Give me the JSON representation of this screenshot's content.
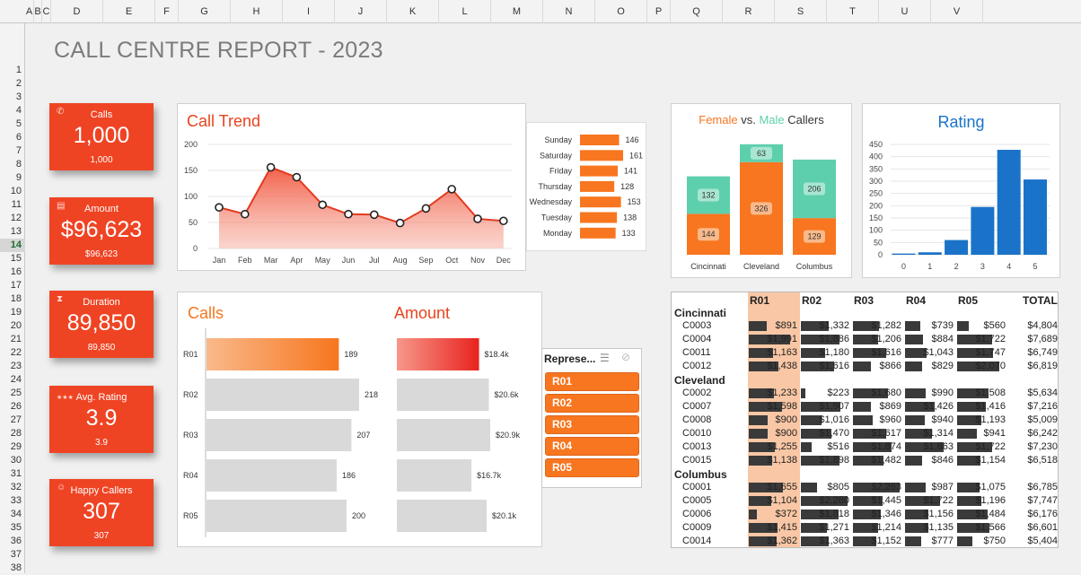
{
  "sheet": {
    "columns": [
      "A",
      "B",
      "C",
      "D",
      "E",
      "F",
      "G",
      "H",
      "I",
      "J",
      "K",
      "L",
      "M",
      "N",
      "O",
      "P",
      "Q",
      "R",
      "S",
      "T",
      "U",
      "V"
    ],
    "rows": [
      "1",
      "2",
      "3",
      "4",
      "5",
      "6",
      "7",
      "8",
      "9",
      "10",
      "11",
      "12",
      "13",
      "14",
      "15",
      "16",
      "17",
      "18",
      "19",
      "20",
      "21",
      "22",
      "23",
      "24",
      "25",
      "26",
      "27",
      "28",
      "29",
      "30",
      "31",
      "32",
      "33",
      "34",
      "35",
      "36",
      "37",
      "38"
    ],
    "selected_row": "14"
  },
  "title": "CALL CENTRE REPORT - 2023",
  "kpis": [
    {
      "label": "Calls",
      "value": "1,000",
      "sub": "1,000",
      "icon": "phone-icon"
    },
    {
      "label": "Amount",
      "value": "$96,623",
      "sub": "$96,623",
      "icon": "cash-register-icon"
    },
    {
      "label": "Duration",
      "value": "89,850",
      "sub": "89,850",
      "icon": "hourglass-icon"
    },
    {
      "label": "Avg. Rating",
      "value": "3.9",
      "sub": "3.9",
      "icon": "stars-icon"
    },
    {
      "label": "Happy Callers",
      "value": "307",
      "sub": "307",
      "icon": "smiley-icon"
    }
  ],
  "trend_title": "Call Trend",
  "gender_title": {
    "female": "Female",
    "vs": " vs. ",
    "male": "Male",
    "callers": " Callers"
  },
  "rating_title": "Rating",
  "calls_title": "Calls",
  "amount_title": "Amount",
  "slicer": {
    "header": "Represe...",
    "items": [
      "R01",
      "R02",
      "R03",
      "R04",
      "R05"
    ]
  },
  "colors": {
    "accent": "#ef4424",
    "orange": "#f7761f",
    "teal": "#5ecfac",
    "blue": "#1a73c8"
  },
  "chart_data": [
    {
      "type": "area",
      "title": "Call Trend",
      "categories": [
        "Jan",
        "Feb",
        "Mar",
        "Apr",
        "May",
        "Jun",
        "Jul",
        "Aug",
        "Sep",
        "Oct",
        "Nov",
        "Dec"
      ],
      "values": [
        79,
        66,
        156,
        137,
        84,
        66,
        65,
        49,
        77,
        114,
        57,
        53
      ],
      "ylim": [
        0,
        200
      ],
      "yticks": [
        0,
        50,
        100,
        150,
        200
      ]
    },
    {
      "type": "bar",
      "orientation": "horizontal",
      "categories": [
        "Sunday",
        "Saturday",
        "Friday",
        "Thursday",
        "Wednesday",
        "Tuesday",
        "Monday"
      ],
      "values": [
        146,
        161,
        141,
        128,
        153,
        138,
        133
      ]
    },
    {
      "type": "bar",
      "stacked": true,
      "title": "Female vs. Male Callers",
      "categories": [
        "Cincinnati",
        "Cleveland",
        "Columbus"
      ],
      "series": [
        {
          "name": "Female",
          "values": [
            144,
            326,
            129
          ]
        },
        {
          "name": "Male",
          "values": [
            132,
            63,
            206
          ]
        }
      ]
    },
    {
      "type": "bar",
      "title": "Rating",
      "categories": [
        "0",
        "1",
        "2",
        "3",
        "4",
        "5"
      ],
      "values": [
        5,
        10,
        60,
        195,
        428,
        307
      ],
      "ylim": [
        0,
        450
      ],
      "yticks": [
        0,
        50,
        100,
        150,
        200,
        250,
        300,
        350,
        400,
        450
      ]
    },
    {
      "type": "bar",
      "orientation": "horizontal",
      "title": "Calls",
      "categories": [
        "R01",
        "R02",
        "R03",
        "R04",
        "R05"
      ],
      "values": [
        189,
        218,
        207,
        186,
        200
      ]
    },
    {
      "type": "bar",
      "orientation": "horizontal",
      "title": "Amount",
      "categories": [
        "R01",
        "R02",
        "R03",
        "R04",
        "R05"
      ],
      "values": [
        18.4,
        20.6,
        20.9,
        16.7,
        20.1
      ],
      "labels": [
        "$18.4k",
        "$20.6k",
        "$20.9k",
        "$16.7k",
        "$20.1k"
      ]
    },
    {
      "type": "table",
      "headers": [
        "R01",
        "R02",
        "R03",
        "R04",
        "R05",
        "TOTAL"
      ],
      "groups": [
        {
          "city": "Cincinnati",
          "rows": [
            {
              "code": "C0003",
              "vals": [
                891,
                1332,
                1282,
                739,
                560
              ],
              "labels": [
                "$891",
                "$1,332",
                "$1,282",
                "$739",
                "$560"
              ],
              "total": "$4,804"
            },
            {
              "code": "C0004",
              "vals": [
                1991,
                1886,
                1206,
                884,
                1722
              ],
              "labels": [
                "$1,991",
                "$1,886",
                "$1,206",
                "$884",
                "$1,722"
              ],
              "total": "$7,689"
            },
            {
              "code": "C0011",
              "vals": [
                1163,
                1180,
                1616,
                1043,
                1747
              ],
              "labels": [
                "$1,163",
                "$1,180",
                "$1,616",
                "$1,043",
                "$1,747"
              ],
              "total": "$6,749"
            },
            {
              "code": "C0012",
              "vals": [
                1438,
                1616,
                866,
                829,
                2070
              ],
              "labels": [
                "$1,438",
                "$1,616",
                "$866",
                "$829",
                "$2,070"
              ],
              "total": "$6,819"
            }
          ]
        },
        {
          "city": "Cleveland",
          "rows": [
            {
              "code": "C0002",
              "vals": [
                1233,
                223,
                1680,
                990,
                1508
              ],
              "labels": [
                "$1,233",
                "$223",
                "$1,680",
                "$990",
                "$1,508"
              ],
              "total": "$5,634"
            },
            {
              "code": "C0007",
              "vals": [
                1598,
                1907,
                869,
                1426,
                1416
              ],
              "labels": [
                "$1,598",
                "$1,907",
                "$869",
                "$1,426",
                "$1,416"
              ],
              "total": "$7,216"
            },
            {
              "code": "C0008",
              "vals": [
                900,
                1016,
                960,
                940,
                1193
              ],
              "labels": [
                "$900",
                "$1,016",
                "$960",
                "$940",
                "$1,193"
              ],
              "total": "$5,009"
            },
            {
              "code": "C0010",
              "vals": [
                900,
                1470,
                1617,
                1314,
                941
              ],
              "labels": [
                "$900",
                "$1,470",
                "$1,617",
                "$1,314",
                "$941"
              ],
              "total": "$6,242"
            },
            {
              "code": "C0013",
              "vals": [
                1255,
                516,
                1874,
                1863,
                1722
              ],
              "labels": [
                "$1,255",
                "$516",
                "$1,874",
                "$1,863",
                "$1,722"
              ],
              "total": "$7,230"
            },
            {
              "code": "C0015",
              "vals": [
                1138,
                1898,
                1482,
                846,
                1154
              ],
              "labels": [
                "$1,138",
                "$1,898",
                "$1,482",
                "$846",
                "$1,154"
              ],
              "total": "$6,518"
            }
          ]
        },
        {
          "city": "Columbus",
          "rows": [
            {
              "code": "C0001",
              "vals": [
                1655,
                805,
                2263,
                987,
                1075
              ],
              "labels": [
                "$1,655",
                "$805",
                "$2,263",
                "$987",
                "$1,075"
              ],
              "total": "$6,785"
            },
            {
              "code": "C0005",
              "vals": [
                1104,
                2280,
                1445,
                1722,
                1196
              ],
              "labels": [
                "$1,104",
                "$2,280",
                "$1,445",
                "$1,722",
                "$1,196"
              ],
              "total": "$7,747"
            },
            {
              "code": "C0006",
              "vals": [
                372,
                1818,
                1346,
                1156,
                1484
              ],
              "labels": [
                "$372",
                "$1,818",
                "$1,346",
                "$1,156",
                "$1,484"
              ],
              "total": "$6,176"
            },
            {
              "code": "C0009",
              "vals": [
                1415,
                1271,
                1214,
                1135,
                1566
              ],
              "labels": [
                "$1,415",
                "$1,271",
                "$1,214",
                "$1,135",
                "$1,566"
              ],
              "total": "$6,601"
            },
            {
              "code": "C0014",
              "vals": [
                1362,
                1363,
                1152,
                777,
                750
              ],
              "labels": [
                "$1,362",
                "$1,363",
                "$1,152",
                "$777",
                "$750"
              ],
              "total": "$5,404"
            }
          ]
        }
      ]
    }
  ]
}
